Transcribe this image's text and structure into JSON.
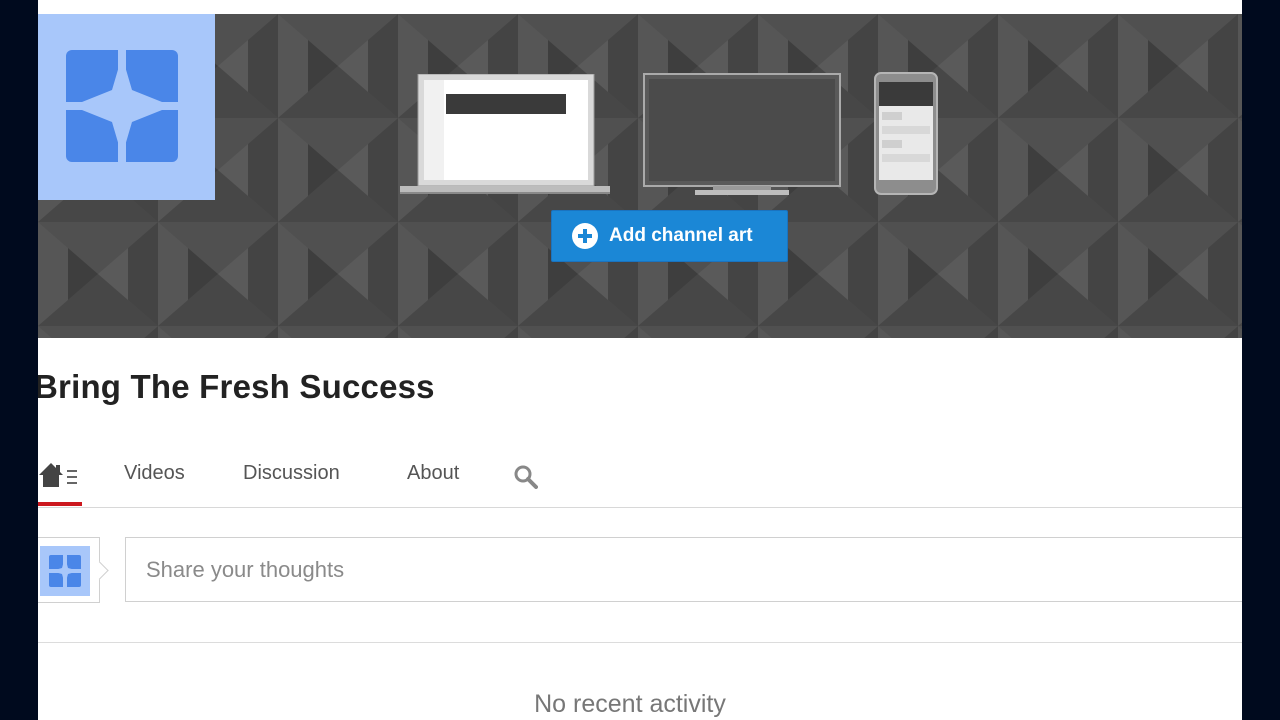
{
  "banner": {
    "add_art_label": "Add channel art",
    "button_color": "#1b87d6"
  },
  "channel": {
    "title": "Bring The Fresh Success",
    "avatar_color": "#a8c7fa"
  },
  "tabs": {
    "items": [
      {
        "label": "Videos"
      },
      {
        "label": "Discussion"
      },
      {
        "label": "About"
      }
    ],
    "active_underline_color": "#cc181e"
  },
  "share": {
    "placeholder": "Share your thoughts"
  },
  "feed": {
    "empty_message": "No recent activity"
  },
  "icons": {
    "home": "home-icon",
    "list": "list-icon",
    "search": "search-icon",
    "plus": "plus-circle-icon"
  }
}
